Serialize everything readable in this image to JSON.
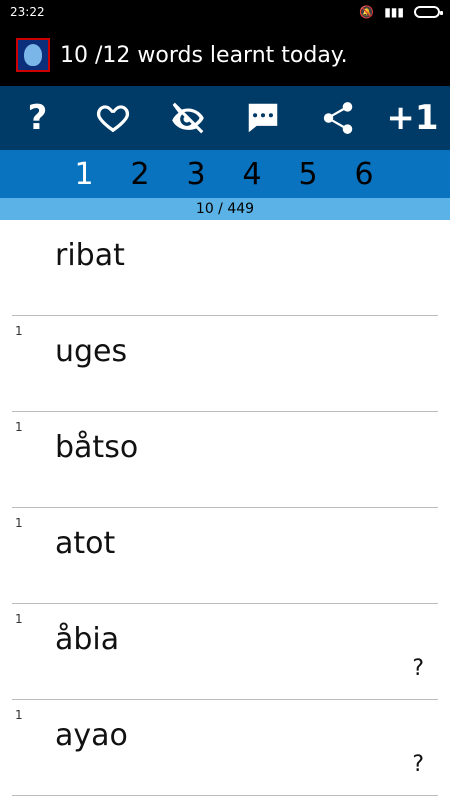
{
  "status_bar": {
    "time": "23:22"
  },
  "header": {
    "title": "10 /12 words learnt today."
  },
  "toolbar": {
    "help_label": "?",
    "plus_one_label": "+1",
    "icons": [
      "help-icon",
      "heart-icon",
      "eye-off-icon",
      "message-icon",
      "share-icon",
      "plus-one-icon"
    ]
  },
  "tabs": [
    "1",
    "2",
    "3",
    "4",
    "5",
    "6"
  ],
  "progress": "10 / 449",
  "list": [
    {
      "count": "",
      "word": "ribat",
      "mark": ""
    },
    {
      "count": "1",
      "word": "uges",
      "mark": ""
    },
    {
      "count": "1",
      "word": "båtso",
      "mark": ""
    },
    {
      "count": "1",
      "word": "atot",
      "mark": ""
    },
    {
      "count": "1",
      "word": "åbia",
      "mark": "?"
    },
    {
      "count": "1",
      "word": "ayao",
      "mark": "?"
    }
  ],
  "colors": {
    "toolbar": "#003a66",
    "tabs": "#0a73c0",
    "progress": "#5ab2e6"
  }
}
